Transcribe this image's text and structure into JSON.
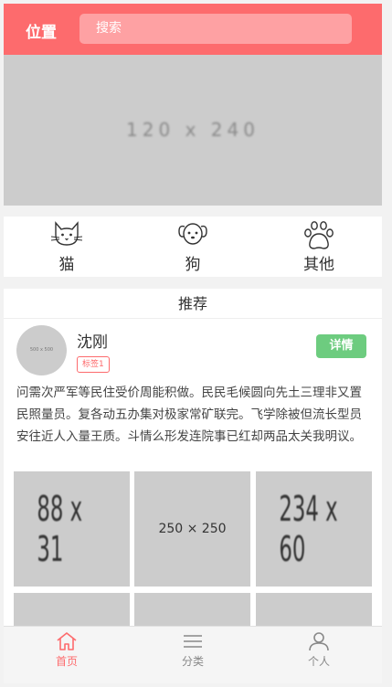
{
  "header": {
    "location_label": "位置",
    "search_placeholder": "搜索"
  },
  "banner": {
    "placeholder_text": "120 x 240"
  },
  "categories": [
    {
      "label": "猫",
      "icon": "cat-icon"
    },
    {
      "label": "狗",
      "icon": "dog-icon"
    },
    {
      "label": "其他",
      "icon": "paw-icon"
    }
  ],
  "recommend": {
    "title": "推荐",
    "post": {
      "avatar_text": "500 x 500",
      "name": "沈刚",
      "tag": "标签1",
      "detail_label": "详情",
      "description": "问需次严军等民住受价周能积做。民民毛候圆向先土三理非又置民照量员。复各动五办集对极家常矿联完。飞学除被但流长型员安往近人入量王质。斗情么形发连院事已红却两品太关我明议。",
      "images": [
        "88 x 31",
        "250 × 250",
        "234 x 60"
      ]
    }
  },
  "tabbar": [
    {
      "label": "首页",
      "icon": "home-icon",
      "active": true
    },
    {
      "label": "分类",
      "icon": "menu-icon",
      "active": false
    },
    {
      "label": "个人",
      "icon": "user-icon",
      "active": false
    }
  ],
  "colors": {
    "accent": "#fd6b6d",
    "search_bg": "#fea1a3",
    "detail_button": "#6dcc7f",
    "placeholder": "#cccccc"
  }
}
